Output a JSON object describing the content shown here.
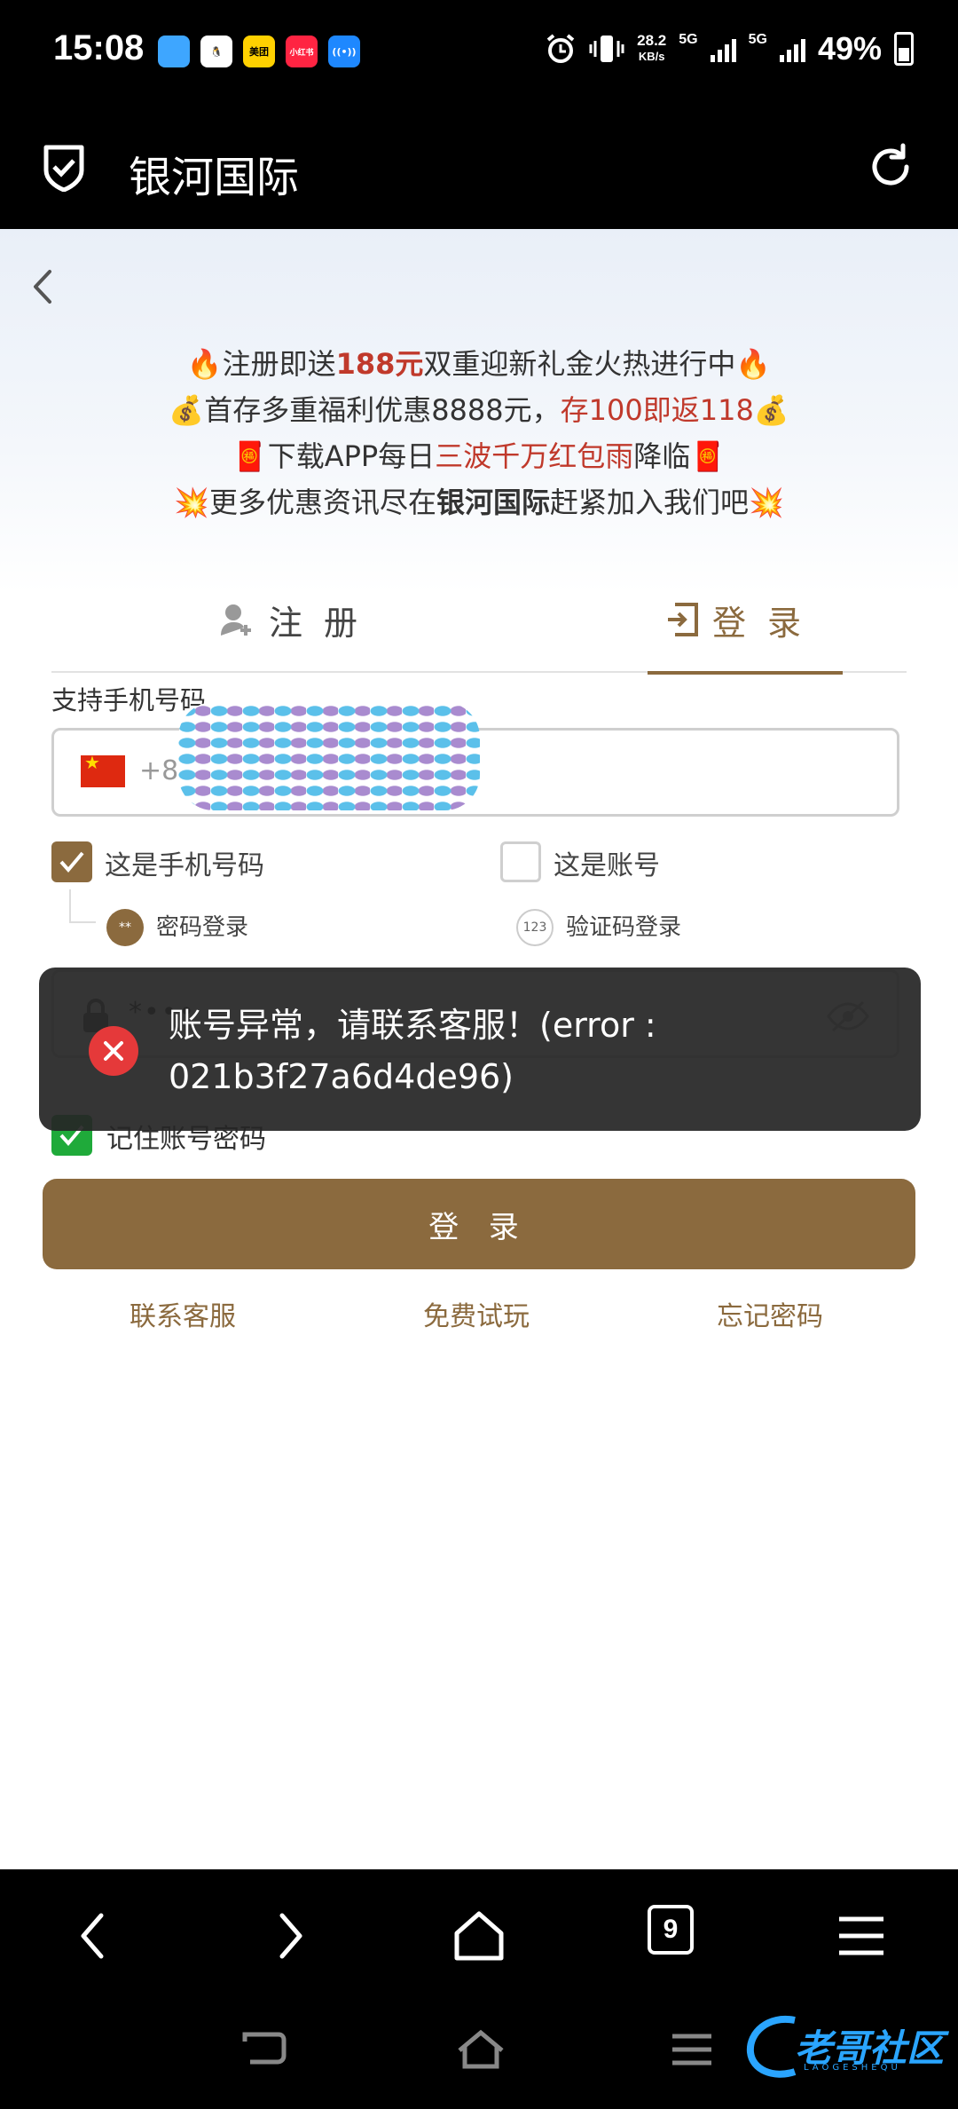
{
  "status_bar": {
    "time": "15:08",
    "apps": [
      {
        "icon": "app-icon-blue",
        "label": "",
        "color": "#3ea6ff"
      },
      {
        "icon": "qq-icon",
        "label": "",
        "color": "#ffffff"
      },
      {
        "icon": "meituan-icon",
        "label": "美团",
        "color": "#ffd100"
      },
      {
        "icon": "xiaohongshu-icon",
        "label": "小红书",
        "color": "#ff2442"
      },
      {
        "icon": "hotspot-icon",
        "label": "",
        "color": "#1e88ff"
      }
    ],
    "net_speed": "28.2",
    "net_unit": "KB/s",
    "sim1": "5G",
    "sim2": "5G",
    "battery": "49%"
  },
  "app_bar": {
    "title": "银河国际"
  },
  "promo": {
    "line1_a": "🔥注册即送",
    "line1_b": "188元",
    "line1_c": "双重迎新礼金火热进行中🔥",
    "line2_a": "💰首存多重福利优惠8888元，",
    "line2_b": "存100即返118",
    "line2_c": "💰",
    "line3_a": "🧧下载APP每日",
    "line3_b": "三波千万红包雨",
    "line3_c": "降临🧧",
    "line4_a": "💥更多优惠资讯尽在",
    "line4_b": "银河国际",
    "line4_c": "赶紧加入我们吧💥"
  },
  "tabs": {
    "register": "注 册",
    "login": "登 录",
    "active": "login"
  },
  "form": {
    "phone_hint": "支持手机号码",
    "dial_code": "+86",
    "opt_phone": "这是手机号码",
    "opt_phone_checked": true,
    "opt_account": "这是账号",
    "opt_account_checked": false,
    "sub_password": "密码登录",
    "sub_password_icon": "**",
    "sub_code": "验证码登录",
    "sub_code_icon": "123",
    "password_value": "*•••",
    "remember": "记住账号密码",
    "remember_checked": true,
    "login_button": "登 录"
  },
  "links": {
    "support": "联系客服",
    "trial": "免费试玩",
    "forgot": "忘记密码"
  },
  "toast": {
    "message": "账号异常，请联系客服！(error : 021b3f27a6d4de96)"
  },
  "browser_nav": {
    "tab_count": "9"
  },
  "watermark": {
    "text": "老哥社区",
    "sub": "LAOGESHEQU"
  },
  "colors": {
    "accent": "#8b6a3e",
    "promo_red": "#c0392b",
    "error_red": "#e5393a",
    "remember_green": "#1faa3a"
  }
}
